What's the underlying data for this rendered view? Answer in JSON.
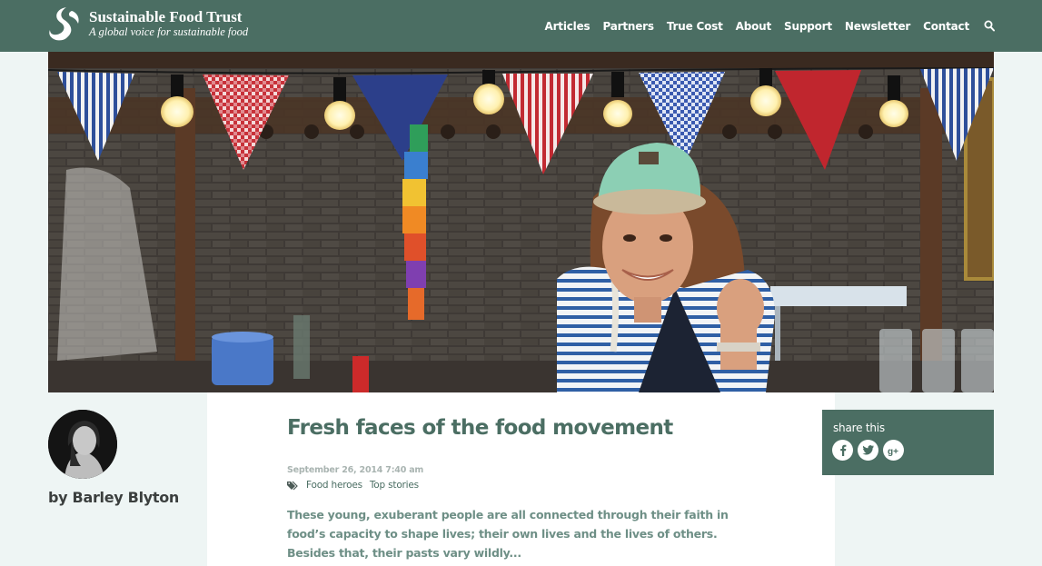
{
  "brand": {
    "name": "Sustainable Food Trust",
    "tagline": "A global voice for sustainable food"
  },
  "nav": {
    "items": [
      "Articles",
      "Partners",
      "True Cost",
      "About",
      "Support",
      "Newsletter",
      "Contact"
    ],
    "search_icon": "search-icon"
  },
  "author": {
    "byline": "by Barley Blyton"
  },
  "article": {
    "title": "Fresh faces of the food movement",
    "date": "September 26, 2014 7:40 am",
    "tag_icon": "tag-icon",
    "tags": [
      "Food heroes",
      "Top stories"
    ],
    "excerpt": "These young, exuberant people are all connected through their faith in food’s capacity to shape lives; their own lives and the lives of others. Besides that, their pasts vary wildly..."
  },
  "share": {
    "label": "share this",
    "icons": [
      "facebook-icon",
      "twitter-icon",
      "google-plus-icon"
    ]
  },
  "colors": {
    "header": "#4b6e63",
    "background": "#eef5f4",
    "title": "#4b6e63",
    "excerpt": "#6e8f86"
  }
}
